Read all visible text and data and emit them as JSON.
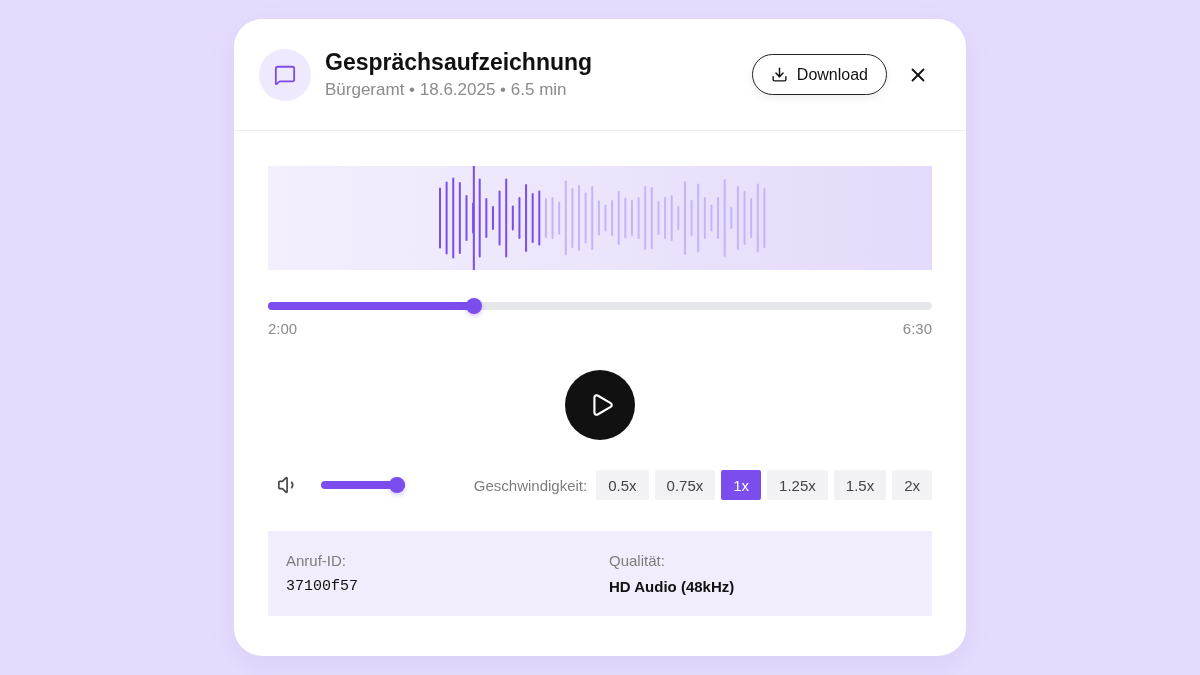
{
  "header": {
    "title": "Gesprächsaufzeichnung",
    "subtitle": "Bürgeramt • 18.6.2025 • 6.5 min",
    "download_button": "Download"
  },
  "player": {
    "progress": {
      "level": 0.31
    },
    "elapsed": "2:00",
    "duration": "6:30"
  },
  "volume": {
    "level": 1
  },
  "speed": {
    "label": "Geschwindigkeit:",
    "options": [
      {
        "label": "0.5x",
        "selected": false
      },
      {
        "label": "0.75x",
        "selected": false
      },
      {
        "label": "1x",
        "selected": true
      },
      {
        "label": "1.25x",
        "selected": false
      },
      {
        "label": "1.5x",
        "selected": false
      },
      {
        "label": "2x",
        "selected": false
      }
    ]
  },
  "details": [
    {
      "label": "Anruf-ID:",
      "value": "37100f57",
      "kind": "code"
    },
    {
      "label": "Qualität:",
      "value": "HD Audio (48kHz)",
      "kind": "text"
    }
  ]
}
